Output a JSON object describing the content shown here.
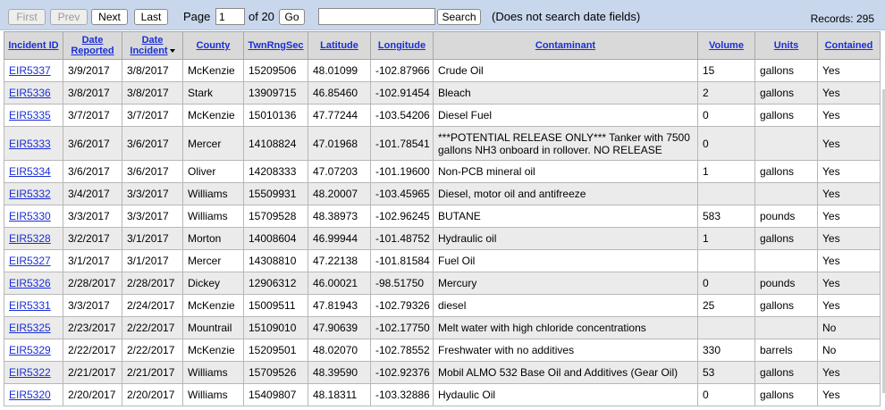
{
  "toolbar": {
    "first_label": "First",
    "prev_label": "Prev",
    "next_label": "Next",
    "last_label": "Last",
    "page_label": "Page",
    "page_value": "1",
    "of_label": "of 20",
    "go_label": "Go",
    "search_value": "",
    "search_label": "Search",
    "search_note": "(Does not search date fields)",
    "records_label": "Records: 295"
  },
  "table": {
    "headers": {
      "incident_id": "Incident ID",
      "date_reported": "Date Reported",
      "date_incident": "Date Incident",
      "county": "County",
      "twnrngsec": "TwnRngSec",
      "latitude": "Latitude",
      "longitude": "Longitude",
      "contaminant": "Contaminant",
      "volume": "Volume",
      "units": "Units",
      "contained": "Contained"
    },
    "rows": [
      {
        "id": "EIR5337",
        "reported": "3/9/2017",
        "incident": "3/8/2017",
        "county": "McKenzie",
        "trs": "15209506",
        "lat": "48.01099",
        "lon": "-102.87966",
        "contaminant": "Crude Oil",
        "volume": "15",
        "units": "gallons",
        "contained": "Yes"
      },
      {
        "id": "EIR5336",
        "reported": "3/8/2017",
        "incident": "3/8/2017",
        "county": "Stark",
        "trs": "13909715",
        "lat": "46.85460",
        "lon": "-102.91454",
        "contaminant": "Bleach",
        "volume": "2",
        "units": "gallons",
        "contained": "Yes"
      },
      {
        "id": "EIR5335",
        "reported": "3/7/2017",
        "incident": "3/7/2017",
        "county": "McKenzie",
        "trs": "15010136",
        "lat": "47.77244",
        "lon": "-103.54206",
        "contaminant": "Diesel Fuel",
        "volume": "0",
        "units": "gallons",
        "contained": "Yes"
      },
      {
        "id": "EIR5333",
        "reported": "3/6/2017",
        "incident": "3/6/2017",
        "county": "Mercer",
        "trs": "14108824",
        "lat": "47.01968",
        "lon": "-101.78541",
        "contaminant": "***POTENTIAL RELEASE ONLY*** Tanker with 7500 gallons NH3 onboard in rollover. NO RELEASE",
        "volume": "0",
        "units": "",
        "contained": "Yes"
      },
      {
        "id": "EIR5334",
        "reported": "3/6/2017",
        "incident": "3/6/2017",
        "county": "Oliver",
        "trs": "14208333",
        "lat": "47.07203",
        "lon": "-101.19600",
        "contaminant": "Non-PCB mineral oil",
        "volume": "1",
        "units": "gallons",
        "contained": "Yes"
      },
      {
        "id": "EIR5332",
        "reported": "3/4/2017",
        "incident": "3/3/2017",
        "county": "Williams",
        "trs": "15509931",
        "lat": "48.20007",
        "lon": "-103.45965",
        "contaminant": "Diesel, motor oil and antifreeze",
        "volume": "",
        "units": "",
        "contained": "Yes"
      },
      {
        "id": "EIR5330",
        "reported": "3/3/2017",
        "incident": "3/3/2017",
        "county": "Williams",
        "trs": "15709528",
        "lat": "48.38973",
        "lon": "-102.96245",
        "contaminant": "BUTANE",
        "volume": "583",
        "units": "pounds",
        "contained": "Yes"
      },
      {
        "id": "EIR5328",
        "reported": "3/2/2017",
        "incident": "3/1/2017",
        "county": "Morton",
        "trs": "14008604",
        "lat": "46.99944",
        "lon": "-101.48752",
        "contaminant": "Hydraulic oil",
        "volume": "1",
        "units": "gallons",
        "contained": "Yes"
      },
      {
        "id": "EIR5327",
        "reported": "3/1/2017",
        "incident": "3/1/2017",
        "county": "Mercer",
        "trs": "14308810",
        "lat": "47.22138",
        "lon": "-101.81584",
        "contaminant": "Fuel Oil",
        "volume": "",
        "units": "",
        "contained": "Yes"
      },
      {
        "id": "EIR5326",
        "reported": "2/28/2017",
        "incident": "2/28/2017",
        "county": "Dickey",
        "trs": "12906312",
        "lat": "46.00021",
        "lon": "-98.51750",
        "contaminant": "Mercury",
        "volume": "0",
        "units": "pounds",
        "contained": "Yes"
      },
      {
        "id": "EIR5331",
        "reported": "3/3/2017",
        "incident": "2/24/2017",
        "county": "McKenzie",
        "trs": "15009511",
        "lat": "47.81943",
        "lon": "-102.79326",
        "contaminant": "diesel",
        "volume": "25",
        "units": "gallons",
        "contained": "Yes"
      },
      {
        "id": "EIR5325",
        "reported": "2/23/2017",
        "incident": "2/22/2017",
        "county": "Mountrail",
        "trs": "15109010",
        "lat": "47.90639",
        "lon": "-102.17750",
        "contaminant": "Melt water with high chloride concentrations",
        "volume": "",
        "units": "",
        "contained": "No"
      },
      {
        "id": "EIR5329",
        "reported": "2/22/2017",
        "incident": "2/22/2017",
        "county": "McKenzie",
        "trs": "15209501",
        "lat": "48.02070",
        "lon": "-102.78552",
        "contaminant": "Freshwater with no additives",
        "volume": "330",
        "units": "barrels",
        "contained": "No"
      },
      {
        "id": "EIR5322",
        "reported": "2/21/2017",
        "incident": "2/21/2017",
        "county": "Williams",
        "trs": "15709526",
        "lat": "48.39590",
        "lon": "-102.92376",
        "contaminant": "Mobil ALMO 532 Base Oil and Additives (Gear Oil)",
        "volume": "53",
        "units": "gallons",
        "contained": "Yes"
      },
      {
        "id": "EIR5320",
        "reported": "2/20/2017",
        "incident": "2/20/2017",
        "county": "Williams",
        "trs": "15409807",
        "lat": "48.18311",
        "lon": "-103.32886",
        "contaminant": "Hydaulic Oil",
        "volume": "0",
        "units": "gallons",
        "contained": "Yes"
      }
    ]
  },
  "colors": {
    "toolbar_bg": "#c9d7ed",
    "header_bg": "#d9d9d9",
    "alt_row_bg": "#ebebeb",
    "link": "#1a2fd6"
  }
}
